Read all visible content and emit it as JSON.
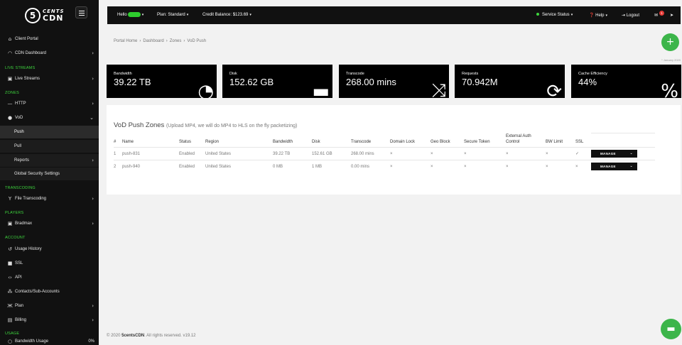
{
  "brand": {
    "line1": "CENTS",
    "line2": "CDN",
    "mark": "5"
  },
  "sidebar": {
    "sections": [
      {
        "label": "LIVE STREAMS"
      },
      {
        "label": "ZONES"
      },
      {
        "label": "TRANSCODING"
      },
      {
        "label": "PLAYERS"
      },
      {
        "label": "ACCOUNT"
      },
      {
        "label": "USAGE"
      }
    ],
    "items": [
      {
        "label": "Client Portal",
        "icon": "home-icon"
      },
      {
        "label": "CDN Dashboard",
        "icon": "gauge-icon"
      },
      {
        "label": "Live Streams",
        "icon": "live-icon"
      },
      {
        "label": "HTTP",
        "icon": "http-icon"
      },
      {
        "label": "VoD",
        "icon": "vod-icon"
      },
      {
        "label": "Push"
      },
      {
        "label": "Pull"
      },
      {
        "label": "Reports"
      },
      {
        "label": "Global Security Settings"
      },
      {
        "label": "File Transcoding",
        "icon": "filter-icon"
      },
      {
        "label": "Bradmax",
        "icon": "player-icon"
      },
      {
        "label": "Usage History",
        "icon": "history-icon"
      },
      {
        "label": "SSL",
        "icon": "lock-icon"
      },
      {
        "label": "API",
        "icon": "code-icon"
      },
      {
        "label": "Contacts/Sub-Accounts",
        "icon": "users-icon"
      },
      {
        "label": "Plan",
        "icon": "plan-icon"
      },
      {
        "label": "Billing",
        "icon": "billing-icon"
      },
      {
        "label": "Bandwidth Usage",
        "icon": "circle-icon",
        "value": "0%"
      }
    ]
  },
  "topbar": {
    "hello": "Hello",
    "plan": "Plan: Standard",
    "credit": "Credit Balance: $123.69",
    "service_status": "Service Status",
    "help": "Help",
    "logout": "Logout",
    "notif_count": "1"
  },
  "breadcrumb": [
    "Portal Home",
    "Dashboard",
    "Zones",
    "VoD Push"
  ],
  "date_note": "* January 2020",
  "stats": [
    {
      "label": "Bandwidth",
      "value": "39.22 TB",
      "icon": "gauge-icon"
    },
    {
      "label": "Disk",
      "value": "152.62 GB",
      "icon": "disk-icon"
    },
    {
      "label": "Transcode",
      "value": "268.00 mins",
      "icon": "shuffle-icon"
    },
    {
      "label": "Requests",
      "value": "70.942M",
      "icon": "sync-icon"
    },
    {
      "label": "Cache Efficiency",
      "value": "44%",
      "icon": "percent-icon"
    }
  ],
  "panel": {
    "title": "VoD Push Zones",
    "subtitle": "(Upload MP4, we will do MP4 to HLS on the fly packetizing)",
    "headers": [
      "#",
      "Name",
      "Status",
      "Region",
      "Bandwidth",
      "Disk",
      "Transcode",
      "Domain Lock",
      "Geo Block",
      "Secure Token",
      "External Auth Control",
      "BW Limit",
      "SSL",
      ""
    ],
    "rows": [
      {
        "num": "1",
        "name": "push-831",
        "status": "Enabled",
        "region": "United States",
        "bandwidth": "39.22 TB",
        "disk": "152.61 GB",
        "transcode": "268.00 mins",
        "domain_lock": "×",
        "geo_block": "×",
        "secure_token": "×",
        "ext_auth": "×",
        "bw_limit": "×",
        "ssl": "✓",
        "action": "MANAGE"
      },
      {
        "num": "2",
        "name": "push-940",
        "status": "Enabled",
        "region": "United States",
        "bandwidth": "0 MB",
        "disk": "1 MB",
        "transcode": "0.00 mins",
        "domain_lock": "×",
        "geo_block": "×",
        "secure_token": "×",
        "ext_auth": "×",
        "bw_limit": "×",
        "ssl": "×",
        "action": "MANAGE"
      }
    ]
  },
  "footer": {
    "prefix": "© 2020",
    "brand": "5centsCDN",
    "suffix": ". All rights reserved. v19.12"
  },
  "colors": {
    "accent": "#3cb54a",
    "section": "#3ed63e",
    "sidebar_bg": "#111111"
  }
}
